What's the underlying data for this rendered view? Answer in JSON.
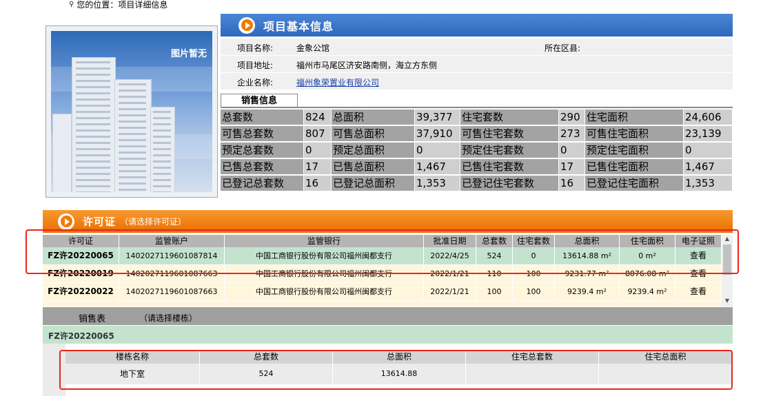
{
  "breadcrumb": {
    "text": "您的位置：项目详细信息"
  },
  "photo": {
    "no_image_label": "图片暂无"
  },
  "basic": {
    "title": "项目基本信息",
    "name_label": "项目名称:",
    "name_value": "金象公馆",
    "district_label": "所在区县:",
    "district_value": "",
    "address_label": "项目地址:",
    "address_value": "福州市马尾区济安路南侧，海立方东侧",
    "company_label": "企业名称:",
    "company_value": "福州象荣置业有限公司"
  },
  "sales": {
    "tab_label": "销售信息",
    "rows": [
      [
        "总套数",
        "824",
        "总面积",
        "39,377",
        "住宅套数",
        "290",
        "住宅面积",
        "24,606"
      ],
      [
        "可售总套数",
        "807",
        "可售总面积",
        "37,910",
        "可售住宅套数",
        "273",
        "可售住宅面积",
        "23,139"
      ],
      [
        "预定总套数",
        "0",
        "预定总面积",
        "0",
        "预定住宅套数",
        "0",
        "预定住宅面积",
        "0"
      ],
      [
        "已售总套数",
        "17",
        "已售总面积",
        "1,467",
        "已售住宅套数",
        "17",
        "已售住宅面积",
        "1,467"
      ],
      [
        "已登记总套数",
        "16",
        "已登记总面积",
        "1,353",
        "已登记住宅套数",
        "16",
        "已登记住宅面积",
        "1,353"
      ]
    ]
  },
  "permit": {
    "title": "许可证",
    "subtitle": "（请选择许可证）",
    "headers": [
      "许可证",
      "监管账户",
      "监管银行",
      "批准日期",
      "总套数",
      "住宅套数",
      "总面积",
      "住宅面积",
      "电子证照"
    ],
    "rows": [
      [
        "FZ许20220065",
        "1402027119601087814",
        "中国工商银行股份有限公司福州闽都支行",
        "2022/4/25",
        "524",
        "0",
        "13614.88 m²",
        "0 m²",
        "查看"
      ],
      [
        "FZ许20220019",
        "1402027119601087663",
        "中国工商银行股份有限公司福州闽都支行",
        "2022/1/21",
        "110",
        "100",
        "9231.77 m²",
        "8076.08 m²",
        "查看"
      ],
      [
        "FZ许20220022",
        "1402027119601087663",
        "中国工商银行股份有限公司福州闽都支行",
        "2022/1/21",
        "100",
        "100",
        "9239.4 m²",
        "9239.4 m²",
        "查看"
      ]
    ]
  },
  "sales_table": {
    "title": "销售表",
    "hint": "（请选择楼栋）",
    "selected_permit": "FZ许20220065",
    "headers": [
      "楼栋名称",
      "总套数",
      "总面积",
      "住宅总套数",
      "住宅总面积"
    ],
    "rows": [
      [
        "地下室",
        "524",
        "13614.88",
        "",
        ""
      ]
    ]
  },
  "colors": {
    "blue_header": "#2f68c0",
    "orange_header": "#ea6e00",
    "selected_row": "#c4e3cf",
    "row_cream": "#fff6dc",
    "annotation": "#e8261c"
  }
}
